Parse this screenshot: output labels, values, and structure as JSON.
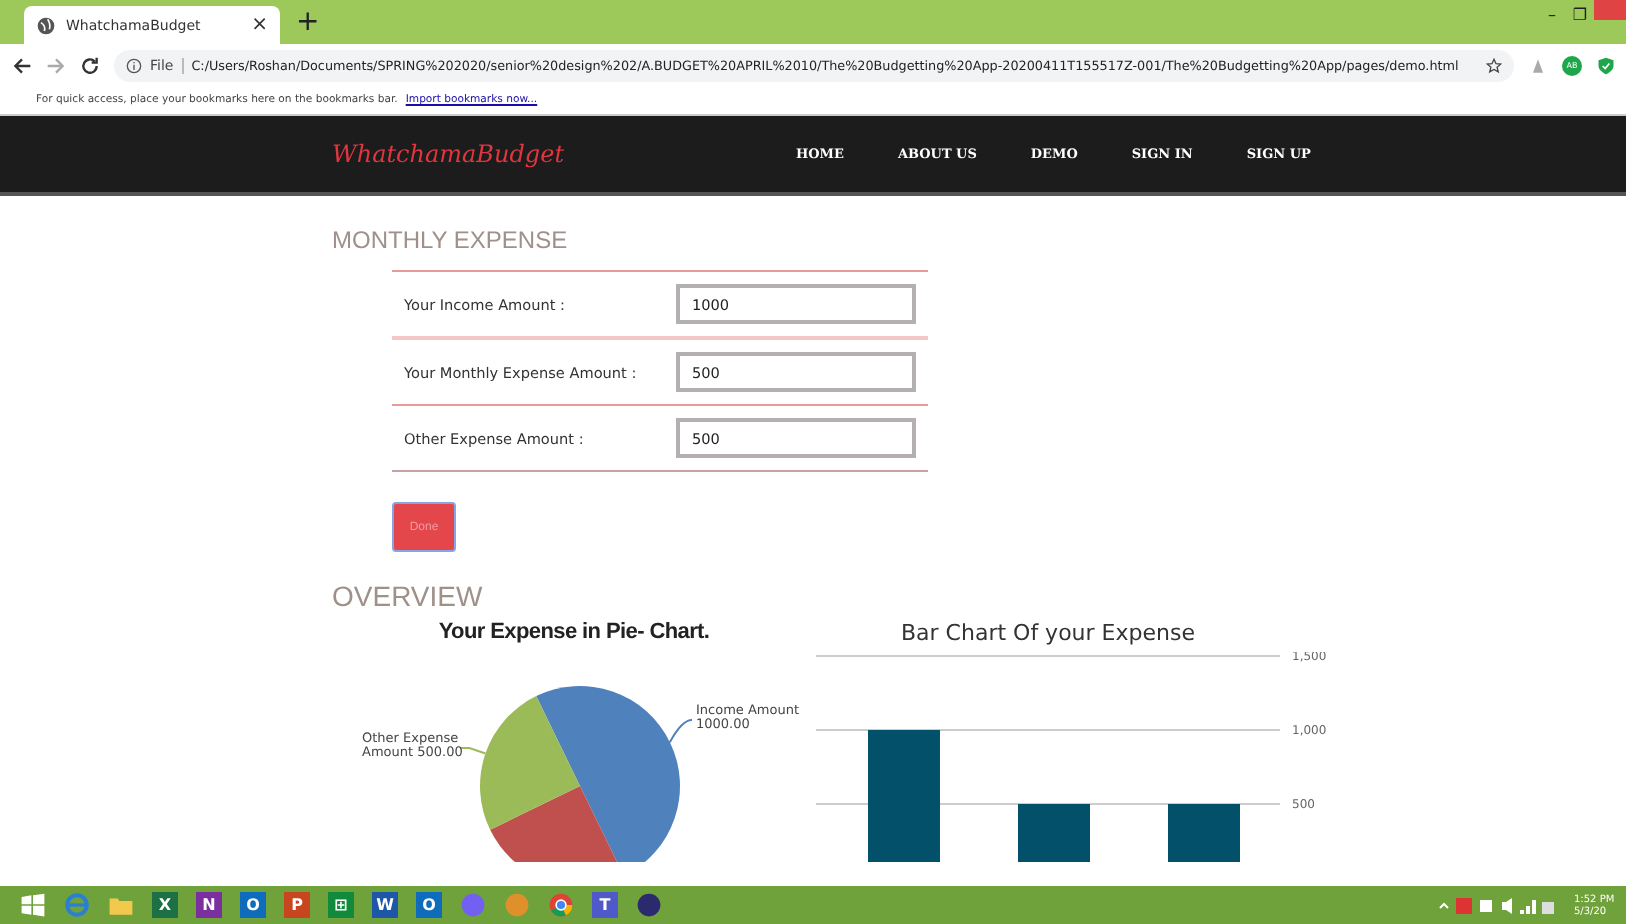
{
  "browser": {
    "tab_title": "WhatchamaBudget",
    "tab_close": "×",
    "new_tab": "+",
    "window_controls": [
      "–",
      "❐"
    ],
    "scheme": "File",
    "url": "C:/Users/Roshan/Documents/SPRING%202020/senior%20design%202/A.BUDGET%20APRIL%2010/The%20Budgetting%20App-20200411T155517Z-001/The%20Budgetting%20App/pages/demo.html",
    "profile_badge": "AB",
    "bookmarks_hint": "For quick access, place your bookmarks here on the bookmarks bar.",
    "bookmarks_link": "Import bookmarks now..."
  },
  "navbar": {
    "brand": "WhatchamaBudget",
    "links": [
      "HOME",
      "ABOUT US",
      "DEMO",
      "SIGN IN",
      "SIGN UP"
    ]
  },
  "monthly_expense": {
    "heading": "MONTHLY EXPENSE",
    "fields": [
      {
        "label": "Your Income Amount :",
        "value": "1000"
      },
      {
        "label": "Your Monthly Expense Amount :",
        "value": "500"
      },
      {
        "label": "Other Expense Amount :",
        "value": "500"
      }
    ],
    "button": "Done"
  },
  "overview": {
    "heading": "OVERVIEW",
    "pie_chart": {
      "chart_data": {
        "type": "pie",
        "title": "Your Expense in Pie- Chart.",
        "values": [
          50,
          25,
          25
        ],
        "colors": [
          "#4f81bd",
          "#c0504d",
          "#9bbb59"
        ]
      },
      "slice_labels": [
        {
          "kind": "right",
          "lines": [
            "Income Amount",
            "1000.00"
          ]
        },
        {
          "kind": "left",
          "lines": [
            "Other Expense",
            "Amount 500.00"
          ]
        }
      ]
    },
    "bar_chart": {
      "chart_data": {
        "type": "bar",
        "title": "Bar Chart Of your Expense",
        "values": [
          1000,
          500,
          500
        ],
        "ylim": [
          0,
          1500
        ],
        "yticks": [
          {
            "value": 500,
            "label": "500"
          },
          {
            "value": 1000,
            "label": "1,000"
          },
          {
            "value": 1500,
            "label": "1,500"
          }
        ]
      }
    }
  },
  "taskbar": {
    "apps": [
      {
        "kind": "start"
      },
      {
        "kind": "browser-e"
      },
      {
        "kind": "folder"
      },
      {
        "kind": "excel",
        "glyph": "X"
      },
      {
        "kind": "onenote",
        "glyph": "N"
      },
      {
        "kind": "outlook",
        "glyph": "O"
      },
      {
        "kind": "powerpoint",
        "glyph": "P"
      },
      {
        "kind": "store",
        "glyph": "⊞"
      },
      {
        "kind": "word",
        "glyph": "W"
      },
      {
        "kind": "outlook",
        "glyph": "O"
      },
      {
        "kind": "viber"
      },
      {
        "kind": "vpn"
      },
      {
        "kind": "chrome"
      },
      {
        "kind": "teams",
        "glyph": "T"
      },
      {
        "kind": "eclipse"
      }
    ],
    "time": "1:52 PM",
    "date": "5/3/20"
  }
}
